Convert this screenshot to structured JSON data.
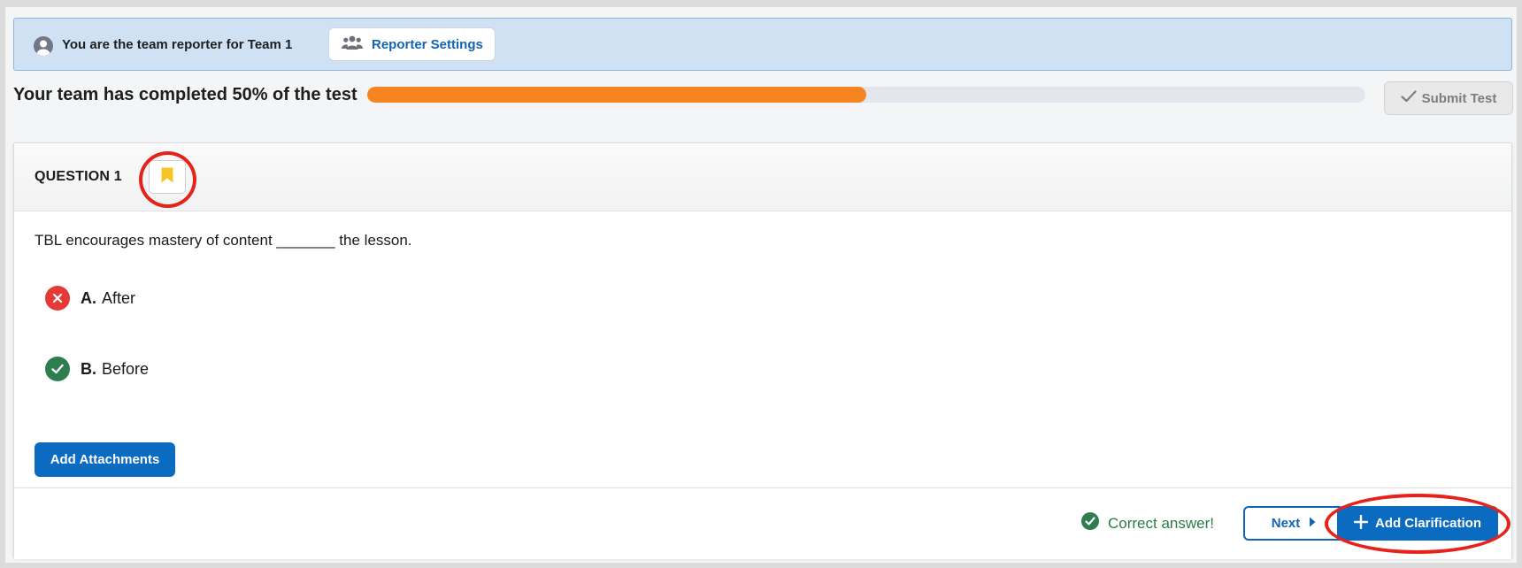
{
  "banner": {
    "text": "You are the team reporter for Team 1",
    "reporter_settings_label": "Reporter Settings",
    "icons": {
      "avatar": "user-circle-icon",
      "settings": "users-icon"
    }
  },
  "progress": {
    "text": "Your team has completed 50% of the test",
    "percent": 50,
    "fill_color": "#f58421"
  },
  "submit": {
    "label": "Submit Test",
    "icon": "check-icon"
  },
  "question": {
    "title": "QUESTION 1",
    "bookmark_icon": "bookmark-icon",
    "text": "TBL encourages mastery of content _______ the lesson.",
    "options": [
      {
        "letter": "A.",
        "text": "After",
        "status": "incorrect",
        "icon": "x-circle-icon",
        "color": "#e53935"
      },
      {
        "letter": "B.",
        "text": "Before",
        "status": "correct",
        "icon": "check-circle-icon",
        "color": "#2e7d4f"
      }
    ],
    "attachments_label": "Add Attachments"
  },
  "footer": {
    "correct_message": "Correct answer!",
    "next_label": "Next",
    "clarification_label": "Add Clarification"
  },
  "colors": {
    "primary": "#0a6bc1",
    "banner_bg": "#cfe1f3",
    "annotation_red": "#e5231b"
  }
}
